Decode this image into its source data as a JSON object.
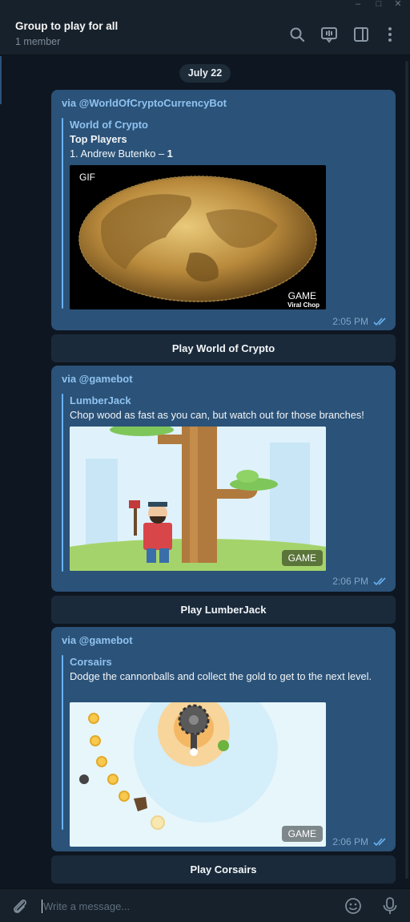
{
  "header": {
    "title": "Group to play for all",
    "subtitle": "1 member"
  },
  "chat": {
    "date": "July 22",
    "messages": [
      {
        "via": "via @WorldOfCryptoCurrencyBot",
        "game_title": "World of Crypto",
        "heading": "Top Players",
        "score_prefix": "1. Andrew Butenko – ",
        "score_value": "1",
        "gif_label": "GIF",
        "media_label": "GAME",
        "watermark": "Viral Chop",
        "time": "2:05 PM",
        "button": "Play World of Crypto"
      },
      {
        "via": "via @gamebot",
        "game_title": "LumberJack",
        "description": "Chop wood as fast as you can, but watch out for those branches!",
        "media_label": "GAME",
        "time": "2:06 PM",
        "button": "Play LumberJack"
      },
      {
        "via": "via @gamebot",
        "game_title": "Corsairs",
        "description": "Dodge the cannonballs and collect the gold to get to the next level.",
        "media_label": "GAME",
        "time": "2:06 PM",
        "button": "Play Corsairs"
      }
    ]
  },
  "composer": {
    "placeholder": "Write a message..."
  },
  "icons": {
    "window": [
      "minimize-icon",
      "maximize-icon",
      "close-icon"
    ],
    "header": [
      "search-icon",
      "video-chat-icon",
      "sidebar-icon",
      "more-icon"
    ],
    "composer": [
      "attach-icon",
      "emoji-icon",
      "microphone-icon"
    ]
  },
  "colors": {
    "background": "#0e1621",
    "header": "#17212b",
    "bubble": "#2b5278",
    "link": "#8fc2f0",
    "button": "#1a2a3a"
  }
}
